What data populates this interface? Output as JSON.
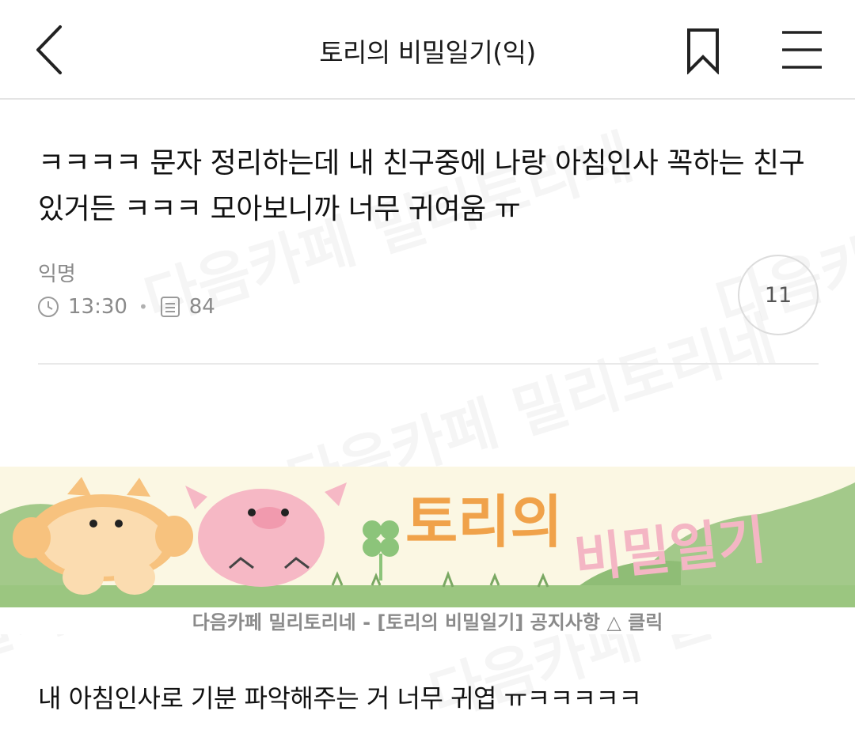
{
  "header": {
    "title": "토리의 비밀일기(익)"
  },
  "post": {
    "title": "ㅋㅋㅋㅋ 문자 정리하는데 내 친구중에 나랑 아침인사 꼭하는 친구 있거든 ㅋㅋㅋ 모아보니까 너무 귀여움 ㅠ",
    "author": "익명",
    "time": "13:30",
    "views": "84",
    "comment_count": "11",
    "body": "내 아침인사로 기분 파악해주는 거 너무 귀엽 ㅠㅋㅋㅋㅋㅋ"
  },
  "banner": {
    "title_part1": "토리의",
    "title_part2": "비밀일기",
    "caption": "다음카페 밀리토리네 - [토리의 비밀일기] 공지사항 △ 클릭"
  },
  "watermark": {
    "text1": "다음카페",
    "text2": "다음카페 밀리토리네",
    "text3": "밀리토리네"
  },
  "icons": {
    "back": "chevron-left-icon",
    "bookmark": "bookmark-icon",
    "menu": "menu-icon",
    "clock": "clock-icon",
    "views": "document-icon"
  },
  "colors": {
    "banner_bg": "#fbf7e3",
    "banner_green": "#a3c98a",
    "title_orange": "#f0a24a",
    "title_pink": "#f4b6c4"
  }
}
